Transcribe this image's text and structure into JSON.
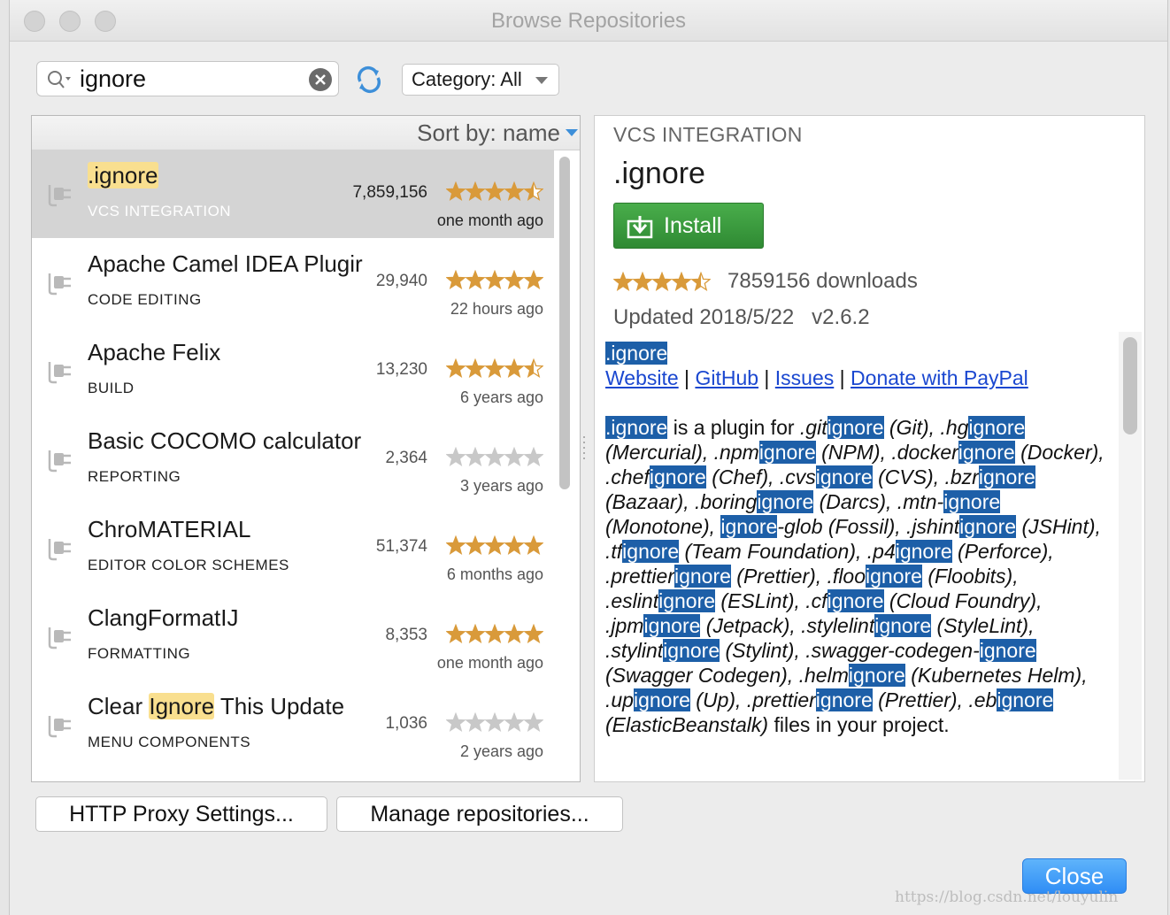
{
  "window": {
    "title": "Browse Repositories"
  },
  "search": {
    "value": "ignore",
    "placeholder": ""
  },
  "category": {
    "label": "Category: All"
  },
  "sort": {
    "label": "Sort by: name"
  },
  "plugins": [
    {
      "name_pre": "",
      "name_hl": ".ignore",
      "name_post": "",
      "category": "VCS INTEGRATION",
      "downloads": "7,859,156",
      "rating": 4.5,
      "updated": "one month ago",
      "selected": true
    },
    {
      "name_pre": "Apache Camel IDEA Plugir",
      "name_hl": "",
      "name_post": "",
      "category": "CODE EDITING",
      "downloads": "29,940",
      "rating": 5,
      "updated": "22 hours ago",
      "selected": false
    },
    {
      "name_pre": "Apache Felix",
      "name_hl": "",
      "name_post": "",
      "category": "BUILD",
      "downloads": "13,230",
      "rating": 4.5,
      "updated": "6 years ago",
      "selected": false
    },
    {
      "name_pre": "Basic COCOMO calculator",
      "name_hl": "",
      "name_post": "",
      "category": "REPORTING",
      "downloads": "2,364",
      "rating": 0,
      "updated": "3 years ago",
      "selected": false
    },
    {
      "name_pre": "ChroMATERIAL",
      "name_hl": "",
      "name_post": "",
      "category": "EDITOR COLOR SCHEMES",
      "downloads": "51,374",
      "rating": 5,
      "updated": "6 months ago",
      "selected": false
    },
    {
      "name_pre": "ClangFormatIJ",
      "name_hl": "",
      "name_post": "",
      "category": "FORMATTING",
      "downloads": "8,353",
      "rating": 5,
      "updated": "one month ago",
      "selected": false
    },
    {
      "name_pre": "Clear ",
      "name_hl": "Ignore",
      "name_post": " This Update",
      "category": "MENU COMPONENTS",
      "downloads": "1,036",
      "rating": 0,
      "updated": "2 years ago",
      "selected": false
    }
  ],
  "detail": {
    "category": "VCS INTEGRATION",
    "title": ".ignore",
    "install_label": "Install",
    "rating": 4.5,
    "downloads": "7859156 downloads",
    "updated": "Updated 2018/5/22   v2.6.2",
    "desc_title": ".ignore",
    "links": [
      "Website",
      "GitHub",
      "Issues",
      "Donate with PayPal"
    ],
    "desc_segments": [
      {
        "t": ".ignore",
        "s": "kw"
      },
      {
        "t": " is a plugin for ",
        "s": ""
      },
      {
        "t": ".git",
        "s": "it"
      },
      {
        "t": "ignore",
        "s": "kw"
      },
      {
        "t": " (Git), .hg",
        "s": "it"
      },
      {
        "t": "ignore",
        "s": "kw"
      },
      {
        "t": " (Mercurial), .npm",
        "s": "it"
      },
      {
        "t": "ignore",
        "s": "kw"
      },
      {
        "t": " (NPM), .docker",
        "s": "it"
      },
      {
        "t": "ignore",
        "s": "kw"
      },
      {
        "t": " (Docker), .chef",
        "s": "it"
      },
      {
        "t": "ignore",
        "s": "kw"
      },
      {
        "t": " (Chef), .cvs",
        "s": "it"
      },
      {
        "t": "ignore",
        "s": "kw"
      },
      {
        "t": " (CVS), .bzr",
        "s": "it"
      },
      {
        "t": "ignore",
        "s": "kw"
      },
      {
        "t": " (Bazaar), .boring",
        "s": "it"
      },
      {
        "t": "ignore",
        "s": "kw"
      },
      {
        "t": " (Darcs), .mtn-",
        "s": "it"
      },
      {
        "t": "ignore",
        "s": "kw"
      },
      {
        "t": " (Monotone), ",
        "s": "it"
      },
      {
        "t": "ignore",
        "s": "kw"
      },
      {
        "t": "-glob (Fossil), .jshint",
        "s": "it"
      },
      {
        "t": "ignore",
        "s": "kw"
      },
      {
        "t": " (JSHint), .tf",
        "s": "it"
      },
      {
        "t": "ignore",
        "s": "kw"
      },
      {
        "t": " (Team Foundation), .p4",
        "s": "it"
      },
      {
        "t": "ignore",
        "s": "kw"
      },
      {
        "t": " (Perforce), .prettier",
        "s": "it"
      },
      {
        "t": "ignore",
        "s": "kw"
      },
      {
        "t": " (Prettier), .floo",
        "s": "it"
      },
      {
        "t": "ignore",
        "s": "kw"
      },
      {
        "t": " (Floobits), .eslint",
        "s": "it"
      },
      {
        "t": "ignore",
        "s": "kw"
      },
      {
        "t": " (ESLint), .cf",
        "s": "it"
      },
      {
        "t": "ignore",
        "s": "kw"
      },
      {
        "t": " (Cloud Foundry), .jpm",
        "s": "it"
      },
      {
        "t": "ignore",
        "s": "kw"
      },
      {
        "t": " (Jetpack), .stylelint",
        "s": "it"
      },
      {
        "t": "ignore",
        "s": "kw"
      },
      {
        "t": " (StyleLint), .stylint",
        "s": "it"
      },
      {
        "t": "ignore",
        "s": "kw"
      },
      {
        "t": " (Stylint), .swagger-codegen-",
        "s": "it"
      },
      {
        "t": "ignore",
        "s": "kw"
      },
      {
        "t": " (Swagger Codegen), .helm",
        "s": "it"
      },
      {
        "t": "ignore",
        "s": "kw"
      },
      {
        "t": " (Kubernetes Helm), .up",
        "s": "it"
      },
      {
        "t": "ignore",
        "s": "kw"
      },
      {
        "t": " (Up), .prettier",
        "s": "it"
      },
      {
        "t": "ignore",
        "s": "kw"
      },
      {
        "t": " (Prettier), .eb",
        "s": "it"
      },
      {
        "t": "ignore",
        "s": "kw"
      },
      {
        "t": " (ElasticBeanstalk)",
        "s": "it"
      },
      {
        "t": " files in your project.",
        "s": ""
      }
    ]
  },
  "footer": {
    "proxy_label": "HTTP Proxy Settings...",
    "manage_label": "Manage repositories...",
    "close_label": "Close"
  },
  "watermark": "https://blog.csdn.net/louyulin",
  "colors": {
    "star": "#d99a3a",
    "star_empty": "#c8c8c8",
    "highlight": "#1d5fa8",
    "install": "#3a9a3d",
    "close": "#2f8df5"
  }
}
